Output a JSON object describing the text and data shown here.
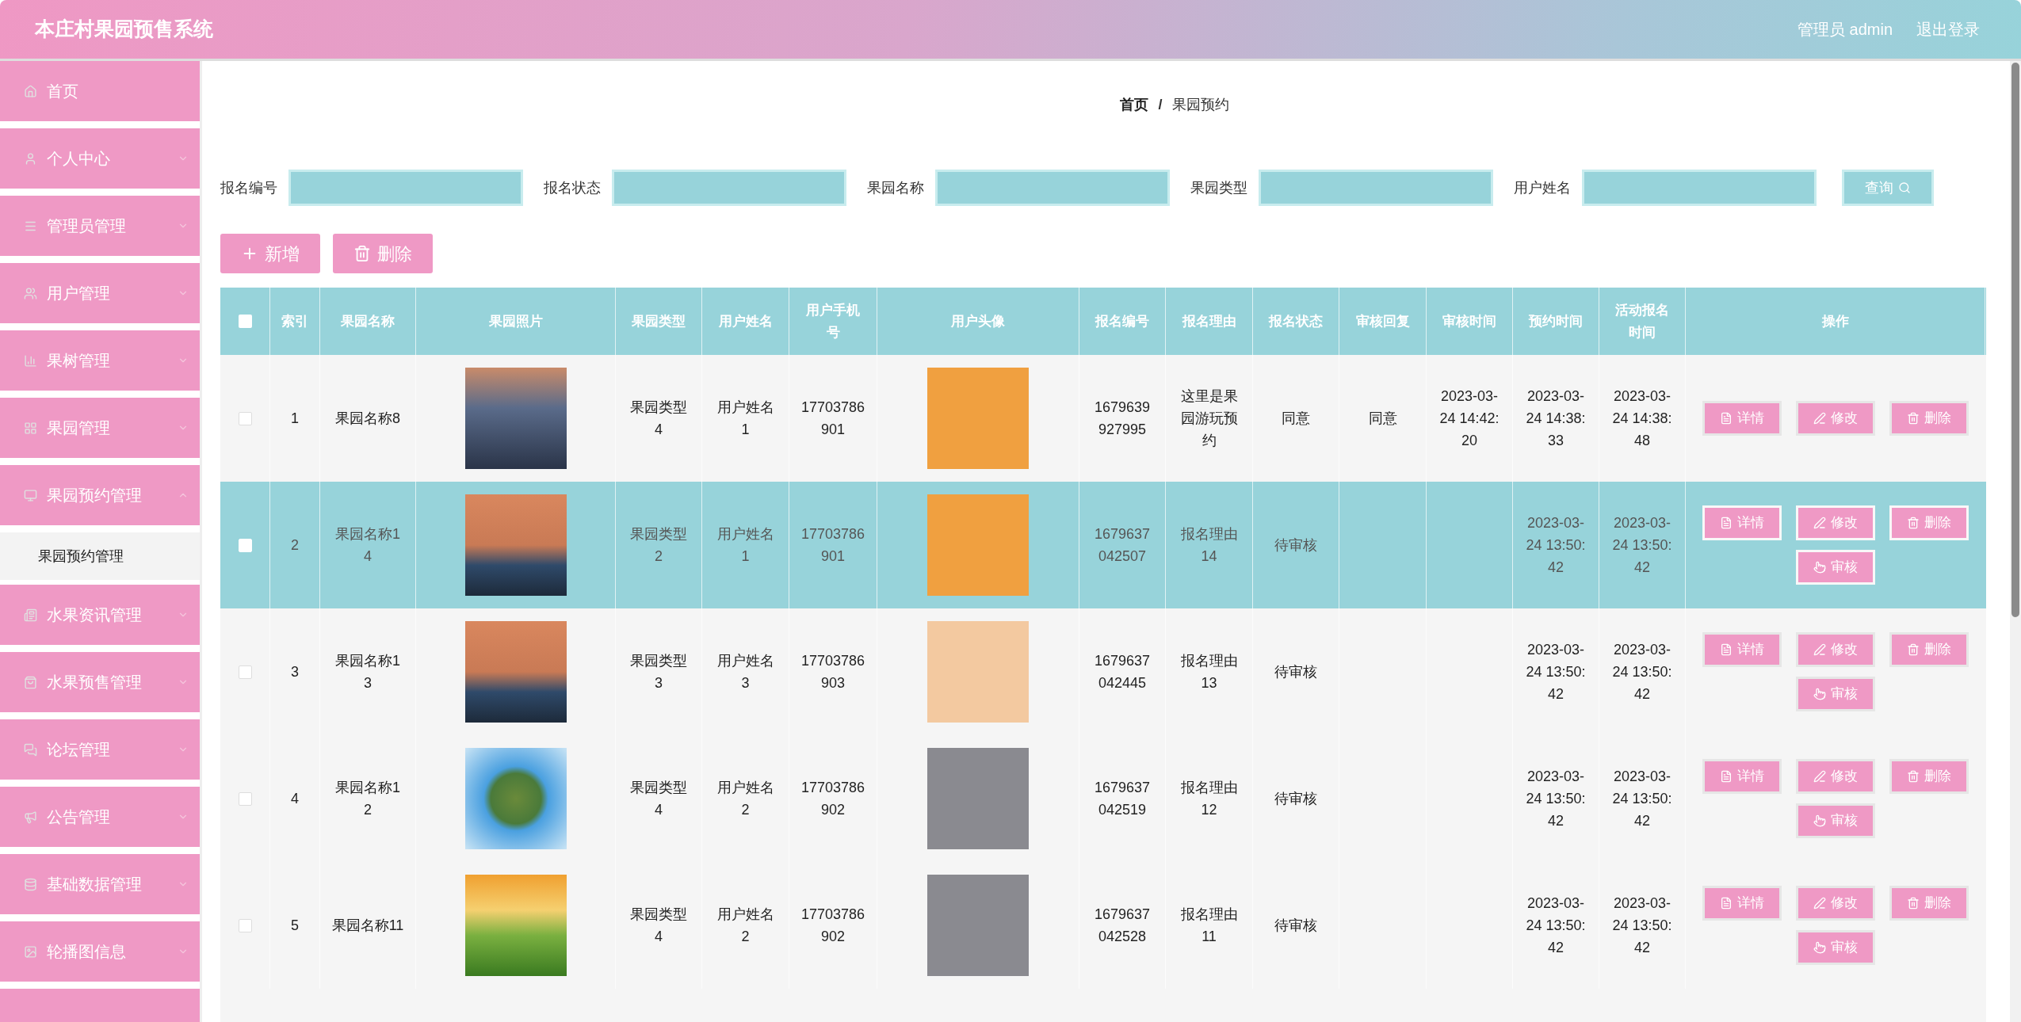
{
  "header": {
    "title": "本庄村果园预售系统",
    "user": "管理员 admin",
    "logout": "退出登录"
  },
  "sidebar": {
    "items": [
      {
        "label": "首页",
        "kind": "link"
      },
      {
        "label": "个人中心",
        "kind": "menu",
        "expanded": false
      },
      {
        "label": "管理员管理",
        "kind": "menu",
        "expanded": false
      },
      {
        "label": "用户管理",
        "kind": "menu",
        "expanded": false
      },
      {
        "label": "果树管理",
        "kind": "menu",
        "expanded": false
      },
      {
        "label": "果园管理",
        "kind": "menu",
        "expanded": false
      },
      {
        "label": "果园预约管理",
        "kind": "menu",
        "expanded": true,
        "children": [
          {
            "label": "果园预约管理",
            "selected": true
          }
        ]
      },
      {
        "label": "水果资讯管理",
        "kind": "menu",
        "expanded": false
      },
      {
        "label": "水果预售管理",
        "kind": "menu",
        "expanded": false
      },
      {
        "label": "论坛管理",
        "kind": "menu",
        "expanded": false
      },
      {
        "label": "公告管理",
        "kind": "menu",
        "expanded": false
      },
      {
        "label": "基础数据管理",
        "kind": "menu",
        "expanded": false
      },
      {
        "label": "轮播图信息",
        "kind": "menu",
        "expanded": false
      }
    ]
  },
  "breadcrumb": {
    "items": [
      "首页",
      "果园预约"
    ],
    "separator": "/"
  },
  "search": {
    "fields": [
      {
        "label": "报名编号"
      },
      {
        "label": "报名状态"
      },
      {
        "label": "果园名称"
      },
      {
        "label": "果园类型"
      },
      {
        "label": "用户姓名"
      }
    ],
    "button": "查询"
  },
  "toolbar": [
    {
      "label": "新增",
      "kind": "add"
    },
    {
      "label": "删除",
      "kind": "delete"
    }
  ],
  "table": {
    "select_all_checked": false,
    "columns": [
      "索引",
      "果园名称",
      "果园照片",
      "果园类型",
      "用户姓名",
      "用户手机号",
      "用户头像",
      "报名编号",
      "报名理由",
      "报名状态",
      "审核回复",
      "审核时间",
      "预约时间",
      "活动报名时间",
      "操作"
    ],
    "rows": [
      {
        "selected": false,
        "checked": false,
        "index": "1",
        "name": "果园名称8",
        "type": "果园类型4",
        "user": "用户姓名1",
        "phone": "17703786901",
        "number": "1679639927995",
        "reason": "这里是果园游玩预约",
        "status": "同意",
        "reply": "同意",
        "audit_time": "2023-03-24 14:42:20",
        "appt_time": "2023-03-24 14:38:33",
        "activity_time": "2023-03-24 14:38:48",
        "actions": [
          {
            "label": "详情",
            "kind": "detail"
          },
          {
            "label": "修改",
            "kind": "edit"
          },
          {
            "label": "删除",
            "kind": "delete"
          }
        ]
      },
      {
        "selected": true,
        "checked": false,
        "index": "2",
        "name": "果园名称14",
        "type": "果园类型2",
        "user": "用户姓名1",
        "phone": "17703786901",
        "number": "1679637042507",
        "reason": "报名理由14",
        "status": "待审核",
        "appt_time": "2023-03-24 13:50:42",
        "activity_time": "2023-03-24 13:50:42",
        "actions": [
          {
            "label": "详情",
            "kind": "detail"
          },
          {
            "label": "修改",
            "kind": "edit"
          },
          {
            "label": "删除",
            "kind": "delete"
          },
          {
            "label": "审核",
            "kind": "audit"
          }
        ]
      },
      {
        "selected": false,
        "checked": false,
        "index": "3",
        "name": "果园名称13",
        "type": "果园类型3",
        "user": "用户姓名3",
        "phone": "17703786903",
        "number": "1679637042445",
        "reason": "报名理由13",
        "status": "待审核",
        "appt_time": "2023-03-24 13:50:42",
        "activity_time": "2023-03-24 13:50:42",
        "actions": [
          {
            "label": "详情",
            "kind": "detail"
          },
          {
            "label": "修改",
            "kind": "edit"
          },
          {
            "label": "删除",
            "kind": "delete"
          },
          {
            "label": "审核",
            "kind": "audit"
          }
        ]
      },
      {
        "selected": false,
        "checked": false,
        "index": "4",
        "name": "果园名称12",
        "type": "果园类型4",
        "user": "用户姓名2",
        "phone": "17703786902",
        "number": "1679637042519",
        "reason": "报名理由12",
        "status": "待审核",
        "appt_time": "2023-03-24 13:50:42",
        "activity_time": "2023-03-24 13:50:42",
        "actions": [
          {
            "label": "详情",
            "kind": "detail"
          },
          {
            "label": "修改",
            "kind": "edit"
          },
          {
            "label": "删除",
            "kind": "delete"
          },
          {
            "label": "审核",
            "kind": "audit"
          }
        ]
      },
      {
        "selected": false,
        "checked": false,
        "index": "5",
        "name": "果园名称11",
        "type": "果园类型4",
        "user": "用户姓名2",
        "phone": "17703786902",
        "number": "1679637042528",
        "reason": "报名理由11",
        "status": "待审核",
        "appt_time": "2023-03-24 13:50:42",
        "activity_time": "2023-03-24 13:50:42",
        "actions": [
          {
            "label": "详情",
            "kind": "detail"
          },
          {
            "label": "修改",
            "kind": "edit"
          },
          {
            "label": "删除",
            "kind": "delete"
          },
          {
            "label": "审核",
            "kind": "audit"
          }
        ]
      }
    ]
  }
}
